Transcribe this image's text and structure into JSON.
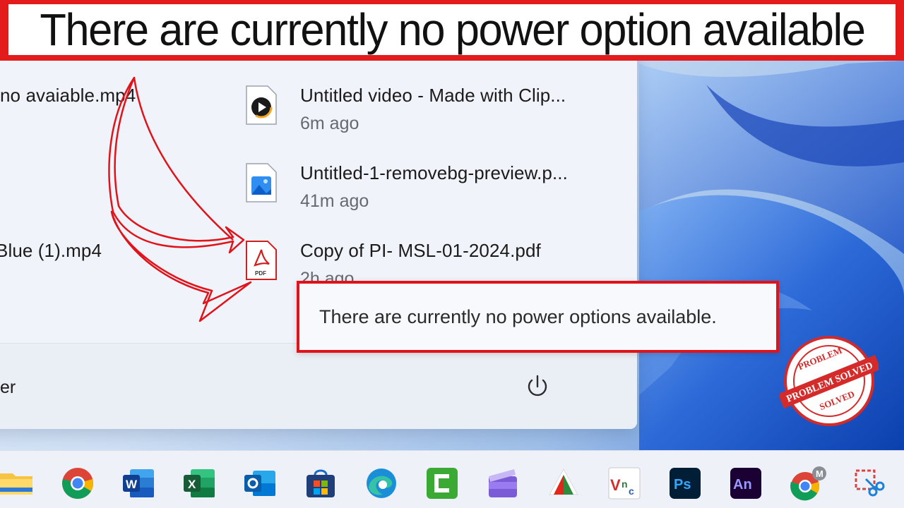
{
  "banner": {
    "title": "There are currently no power option available"
  },
  "start_menu": {
    "recommended_left": [
      {
        "name": "no avaiable.mp4"
      },
      {
        "name": "Blue (1).mp4"
      }
    ],
    "recommended_right": [
      {
        "name": "Untitled video - Made with Clip...",
        "time": "6m ago",
        "icon": "video-play-icon"
      },
      {
        "name": "Untitled-1-removebg-preview.p...",
        "time": "41m ago",
        "icon": "image-file-icon"
      },
      {
        "name": "Copy of PI- MSL-01-2024.pdf",
        "time": "2h ago",
        "icon": "pdf-file-icon"
      }
    ],
    "user_label": "er",
    "power_icon": "power-icon"
  },
  "tooltip": {
    "text": "There are currently no power options available."
  },
  "taskbar": {
    "apps": [
      {
        "name": "file-explorer-icon"
      },
      {
        "name": "chrome-icon"
      },
      {
        "name": "word-icon",
        "label": "W"
      },
      {
        "name": "excel-icon",
        "label": "X"
      },
      {
        "name": "outlook-icon",
        "label": "O"
      },
      {
        "name": "microsoft-store-icon"
      },
      {
        "name": "edge-icon"
      },
      {
        "name": "camtasia-icon"
      },
      {
        "name": "clipchamp-icon"
      },
      {
        "name": "foxit-icon"
      },
      {
        "name": "vnc-icon",
        "label": "Vnc"
      },
      {
        "name": "photoshop-icon",
        "label": "Ps"
      },
      {
        "name": "animate-icon",
        "label": "An"
      },
      {
        "name": "chrome-profile-icon",
        "badge": "M"
      },
      {
        "name": "snipping-tool-icon"
      }
    ]
  },
  "stamp": {
    "text_top": "PROBLEM",
    "text_mid": "PROBLEM SOLVED",
    "text_bottom": "SOLVED"
  },
  "colors": {
    "accent_red": "#e31b1b",
    "windows_blue": "#1f5fd6"
  }
}
